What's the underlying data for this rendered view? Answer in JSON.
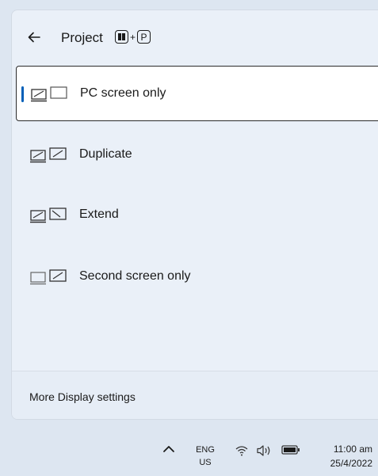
{
  "panel": {
    "title": "Project",
    "shortcut": {
      "plus": "+",
      "key2": "P"
    },
    "options": [
      {
        "label": "PC screen only",
        "icon": "pc-screen-only-icon",
        "selected": true
      },
      {
        "label": "Duplicate",
        "icon": "duplicate-icon",
        "selected": false
      },
      {
        "label": "Extend",
        "icon": "extend-icon",
        "selected": false
      },
      {
        "label": "Second screen only",
        "icon": "second-screen-only-icon",
        "selected": false
      }
    ],
    "footer_link": "More Display settings"
  },
  "taskbar": {
    "lang_top": "ENG",
    "lang_bottom": "US",
    "time": "11:00 am",
    "date": "25/4/2022"
  },
  "colors": {
    "accent": "#005fb8",
    "panel_bg": "#eaf0f8",
    "taskbar_bg": "#dde6f1"
  }
}
